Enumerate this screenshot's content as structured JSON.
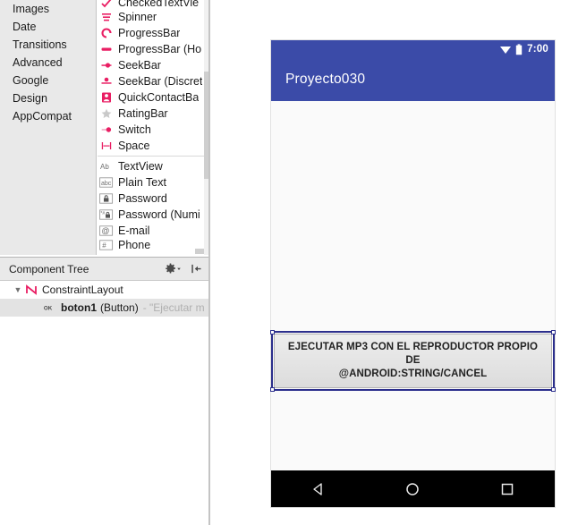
{
  "palette": {
    "categories": [
      {
        "label": "Images"
      },
      {
        "label": "Date"
      },
      {
        "label": "Transitions"
      },
      {
        "label": "Advanced"
      },
      {
        "label": "Google"
      },
      {
        "label": "Design"
      },
      {
        "label": "AppCompat"
      }
    ],
    "items": [
      {
        "label": "CheckedTextVie",
        "icon": "checked-text-view-icon"
      },
      {
        "label": "Spinner",
        "icon": "spinner-icon"
      },
      {
        "label": "ProgressBar",
        "icon": "progressbar-icon"
      },
      {
        "label": "ProgressBar (Ho",
        "icon": "progressbar-horizontal-icon"
      },
      {
        "label": "SeekBar",
        "icon": "seekbar-icon"
      },
      {
        "label": "SeekBar (Discret",
        "icon": "seekbar-discrete-icon"
      },
      {
        "label": "QuickContactBa",
        "icon": "quickcontactbadge-icon"
      },
      {
        "label": "RatingBar",
        "icon": "ratingbar-icon"
      },
      {
        "label": "Switch",
        "icon": "switch-icon"
      },
      {
        "label": "Space",
        "icon": "space-icon"
      },
      {
        "label": "TextView",
        "icon": "textview-icon"
      },
      {
        "label": "Plain Text",
        "icon": "plain-text-icon"
      },
      {
        "label": "Password",
        "icon": "password-icon"
      },
      {
        "label": "Password (Numi",
        "icon": "password-numeric-icon"
      },
      {
        "label": "E-mail",
        "icon": "email-icon"
      },
      {
        "label": "Phone",
        "icon": "phone-icon"
      }
    ]
  },
  "component_tree": {
    "title": "Component Tree",
    "settings_icon": "gear-icon",
    "collapse_icon": "collapse-all-icon",
    "nodes": {
      "root": {
        "expand_arrow": "▼",
        "icon": "constraintlayout-icon",
        "label": "ConstraintLayout"
      },
      "child": {
        "icon": "button-ok-icon",
        "id": "boton1",
        "type": "(Button)",
        "description": "- \"Ejecutar m"
      }
    }
  },
  "preview": {
    "status_bar": {
      "wifi_icon": "wifi-icon",
      "battery_icon": "battery-icon",
      "time": "7:00"
    },
    "app_title": "Proyecto030",
    "button": {
      "line1": "EJECUTAR MP3 CON EL REPRODUCTOR PROPIO DE",
      "line2": "@ANDROID:STRING/CANCEL"
    },
    "nav_bar": {
      "back_icon": "nav-back-triangle-icon",
      "home_icon": "nav-home-circle-icon",
      "recents_icon": "nav-recents-square-icon"
    }
  },
  "colors": {
    "accent_pink": "#e91e63",
    "android_primary": "#3b4ba8",
    "selection_blue": "#2b2e8c",
    "panel_gray": "#e9e9e9"
  }
}
